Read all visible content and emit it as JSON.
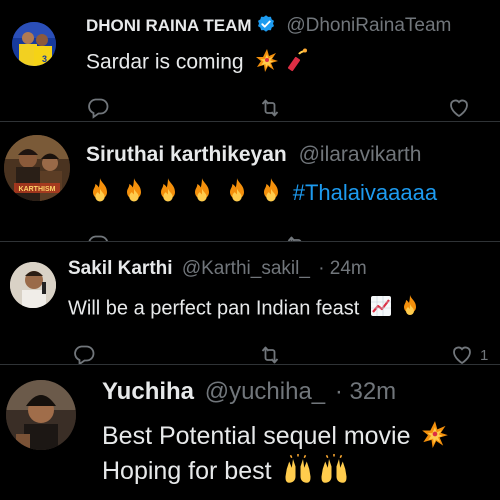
{
  "tweets": [
    {
      "name": "DHONI RAINA TEAM",
      "handle": "@DhoniRainaTeam",
      "verified": true,
      "text": "Sardar is coming",
      "emojis": [
        "collision-emoji",
        "firecracker-emoji"
      ],
      "avatar": "cricket-team-photo",
      "actions": {
        "reply": "",
        "retweet": "",
        "like": ""
      }
    },
    {
      "name": "Siruthai karthikeyan",
      "handle": "@ilaravikarth",
      "text_hashtag": "#Thalaivaaaaa",
      "emojis": [
        "fire-emoji",
        "fire-emoji",
        "fire-emoji",
        "fire-emoji",
        "fire-emoji",
        "fire-emoji"
      ],
      "avatar": "movie-poster-photo",
      "avatar_badge": "KARTHISM"
    },
    {
      "name": "Sakil Karthi",
      "handle": "@Karthi_sakil_",
      "time": "· 24m",
      "text": "Will be a perfect pan Indian feast",
      "emojis": [
        "chart-increasing-emoji",
        "fire-emoji"
      ],
      "avatar": "person-with-microphone-photo",
      "actions": {
        "reply": "",
        "retweet": "",
        "like": "1"
      }
    },
    {
      "name": "Yuchiha",
      "handle": "@yuchiha_",
      "time": "· 32m",
      "text_line1": "Best Potential sequel movie",
      "text_line2": "Hoping for best",
      "emojis_line1": [
        "collision-emoji"
      ],
      "emojis_line2": [
        "raising-hands-emoji",
        "raising-hands-emoji"
      ],
      "avatar": "person-photo"
    }
  ],
  "colors": {
    "background": "#000000",
    "text": "#e7e9ea",
    "muted": "#71767b",
    "link": "#1d9bf0",
    "verified": "#1d9bf0",
    "divider": "#2f3336"
  }
}
